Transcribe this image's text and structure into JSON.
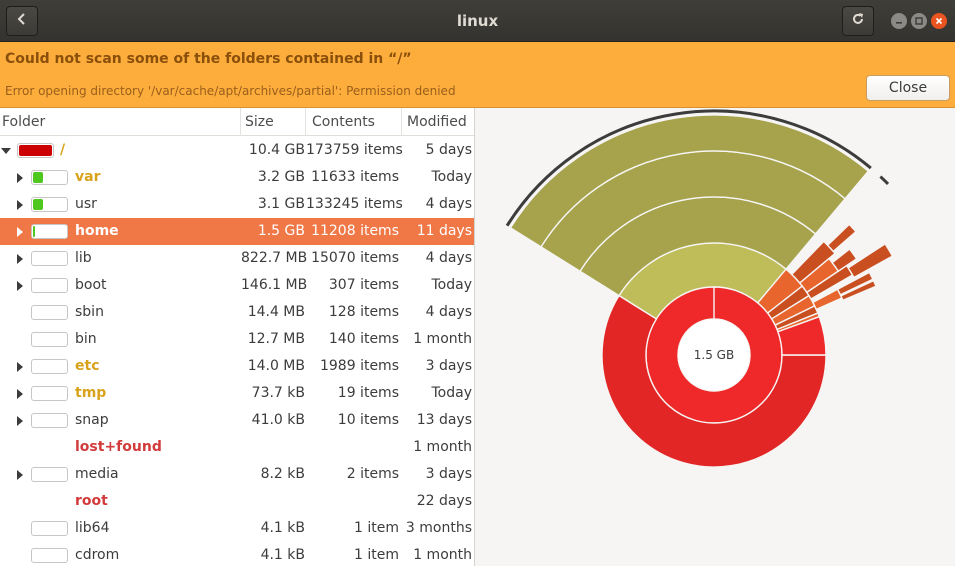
{
  "window": {
    "title": "linux"
  },
  "infobar": {
    "title": "Could not scan some of the folders contained in “/”",
    "message": "Error opening directory '/var/cache/apt/archives/partial': Permission denied",
    "close_label": "Close"
  },
  "columns": {
    "folder": "Folder",
    "size": "Size",
    "contents": "Contents",
    "modified": "Modified"
  },
  "rows": [
    {
      "name": "/",
      "size": "10.4 GB",
      "contents": "173759 items",
      "modified": "5 days",
      "level": 0,
      "expander": "down",
      "bar_fraction": 1.0,
      "bar_color": "#cc0000",
      "style": "warn",
      "selected": false
    },
    {
      "name": "var",
      "size": "3.2 GB",
      "contents": "11633 items",
      "modified": "Today",
      "level": 1,
      "expander": "right",
      "bar_fraction": 0.31,
      "bar_color": "#4ec71e",
      "style": "warn",
      "selected": false
    },
    {
      "name": "usr",
      "size": "3.1 GB",
      "contents": "133245 items",
      "modified": "4 days",
      "level": 1,
      "expander": "right",
      "bar_fraction": 0.3,
      "bar_color": "#4ec71e",
      "style": "normal",
      "selected": false
    },
    {
      "name": "home",
      "size": "1.5 GB",
      "contents": "11208 items",
      "modified": "11 days",
      "level": 1,
      "expander": "right",
      "bar_fraction": 0.14,
      "bar_color": "#4ec71e",
      "style": "normal",
      "selected": true
    },
    {
      "name": "lib",
      "size": "822.7 MB",
      "contents": "15070 items",
      "modified": "4 days",
      "level": 1,
      "expander": "right",
      "bar_fraction": 0.0,
      "bar_color": "#4ec71e",
      "style": "normal",
      "selected": false
    },
    {
      "name": "boot",
      "size": "146.1 MB",
      "contents": "307 items",
      "modified": "Today",
      "level": 1,
      "expander": "right",
      "bar_fraction": 0.0,
      "bar_color": "#4ec71e",
      "style": "normal",
      "selected": false
    },
    {
      "name": "sbin",
      "size": "14.4 MB",
      "contents": "128 items",
      "modified": "4 days",
      "level": 1,
      "expander": "none",
      "bar_fraction": 0.0,
      "bar_color": "#4ec71e",
      "style": "normal",
      "selected": false
    },
    {
      "name": "bin",
      "size": "12.7 MB",
      "contents": "140 items",
      "modified": "1 month",
      "level": 1,
      "expander": "none",
      "bar_fraction": 0.0,
      "bar_color": "#4ec71e",
      "style": "normal",
      "selected": false
    },
    {
      "name": "etc",
      "size": "14.0 MB",
      "contents": "1989 items",
      "modified": "3 days",
      "level": 1,
      "expander": "right",
      "bar_fraction": 0.0,
      "bar_color": "#4ec71e",
      "style": "warn",
      "selected": false
    },
    {
      "name": "tmp",
      "size": "73.7 kB",
      "contents": "19 items",
      "modified": "Today",
      "level": 1,
      "expander": "right",
      "bar_fraction": 0.0,
      "bar_color": "#4ec71e",
      "style": "warn",
      "selected": false
    },
    {
      "name": "snap",
      "size": "41.0 kB",
      "contents": "10 items",
      "modified": "13 days",
      "level": 1,
      "expander": "right",
      "bar_fraction": 0.0,
      "bar_color": "#4ec71e",
      "style": "normal",
      "selected": false
    },
    {
      "name": "lost+found",
      "size": "",
      "contents": "",
      "modified": "1 month",
      "level": 1,
      "expander": "none",
      "bar_fraction": -1,
      "bar_color": "",
      "style": "err",
      "selected": false
    },
    {
      "name": "media",
      "size": "8.2 kB",
      "contents": "2 items",
      "modified": "3 days",
      "level": 1,
      "expander": "right",
      "bar_fraction": 0.0,
      "bar_color": "#4ec71e",
      "style": "normal",
      "selected": false
    },
    {
      "name": "root",
      "size": "",
      "contents": "",
      "modified": "22 days",
      "level": 1,
      "expander": "none",
      "bar_fraction": -1,
      "bar_color": "",
      "style": "err",
      "selected": false
    },
    {
      "name": "lib64",
      "size": "4.1 kB",
      "contents": "1 item",
      "modified": "3 months",
      "level": 1,
      "expander": "none",
      "bar_fraction": 0.0,
      "bar_color": "#4ec71e",
      "style": "normal",
      "selected": false
    },
    {
      "name": "cdrom",
      "size": "4.1 kB",
      "contents": "1 item",
      "modified": "1 month",
      "level": 1,
      "expander": "none",
      "bar_fraction": 0.0,
      "bar_color": "#4ec71e",
      "style": "normal",
      "selected": false
    }
  ],
  "ring_chart": {
    "center_label": "1.5 GB",
    "colors": {
      "root_fill": "#ef2929",
      "root_fill_dark": "#e22525",
      "large_child": "#a6a34c",
      "large_child_inner": "#bfbd5a",
      "small_children": "#e8662e",
      "small_children_dark": "#c94e20",
      "outline": "#3c3c3c"
    }
  }
}
